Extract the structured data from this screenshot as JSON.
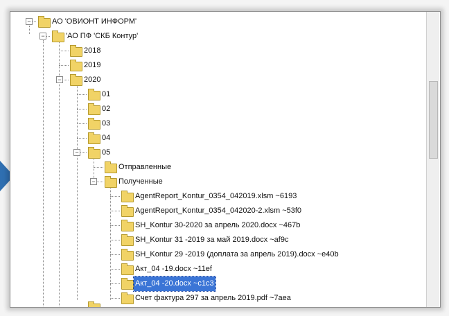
{
  "tree": {
    "items": [
      {
        "label": "АО 'ОВИОНТ ИНФОРМ'",
        "expander": "−"
      },
      {
        "label": "'АО ПФ 'СКБ Контур'",
        "expander": "−"
      },
      {
        "label": "2018",
        "expander": "+"
      },
      {
        "label": "2019",
        "expander": "+"
      },
      {
        "label": "2020",
        "expander": "−"
      },
      {
        "label": "01",
        "expander": "+"
      },
      {
        "label": "02",
        "expander": "+"
      },
      {
        "label": "03",
        "expander": "+"
      },
      {
        "label": "04",
        "expander": "+"
      },
      {
        "label": "05",
        "expander": "−"
      },
      {
        "label": "Отправленные",
        "expander": ""
      },
      {
        "label": "Полученные",
        "expander": "−"
      },
      {
        "label": "AgentReport_Kontur_0354_042019.xlsm ~6193",
        "expander": ""
      },
      {
        "label": "AgentReport_Kontur_0354_042020-2.xlsm ~53f0",
        "expander": ""
      },
      {
        "label": "SH_Kontur 30-2020 за апрель 2020.docx ~467b",
        "expander": ""
      },
      {
        "label": "SH_Kontur  31 -2019 за май 2019.docx ~af9c",
        "expander": ""
      },
      {
        "label": "SH_Kontur 29 -2019 (доплата за апрель 2019).docx ~e40b",
        "expander": ""
      },
      {
        "label": "Акт_04 -19.docx ~11ef",
        "expander": ""
      },
      {
        "label": "Акт_04 -20.docx ~c1c3",
        "expander": "",
        "selected": true
      },
      {
        "label": "Счет фактура 297 за апрель 2019.pdf ~7aea",
        "expander": ""
      }
    ]
  }
}
